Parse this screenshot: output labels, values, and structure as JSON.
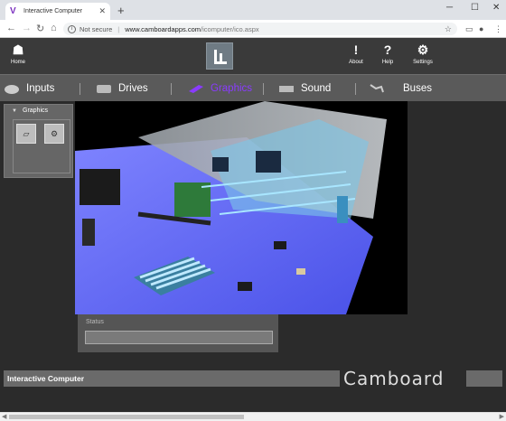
{
  "browser": {
    "tab_title": "Interactive Computer",
    "tab_favicon": "V",
    "address": {
      "security": "Not secure",
      "host": "www.camboardapps.com",
      "path": "/icomputer/ico.aspx"
    }
  },
  "header": {
    "home_label": "Home",
    "about_label": "About",
    "help_label": "Help",
    "settings_label": "Settings"
  },
  "nav": {
    "items": [
      {
        "label": "Inputs"
      },
      {
        "label": "Drives"
      },
      {
        "label": "Graphics"
      },
      {
        "label": "Sound"
      },
      {
        "label": "Buses"
      }
    ],
    "active_index": 2,
    "active_color": "#8a3bff"
  },
  "panel": {
    "title": "Graphics"
  },
  "status": {
    "label": "Status",
    "value": ""
  },
  "footer": {
    "title": "Interactive Computer",
    "brand": "Camboard"
  }
}
